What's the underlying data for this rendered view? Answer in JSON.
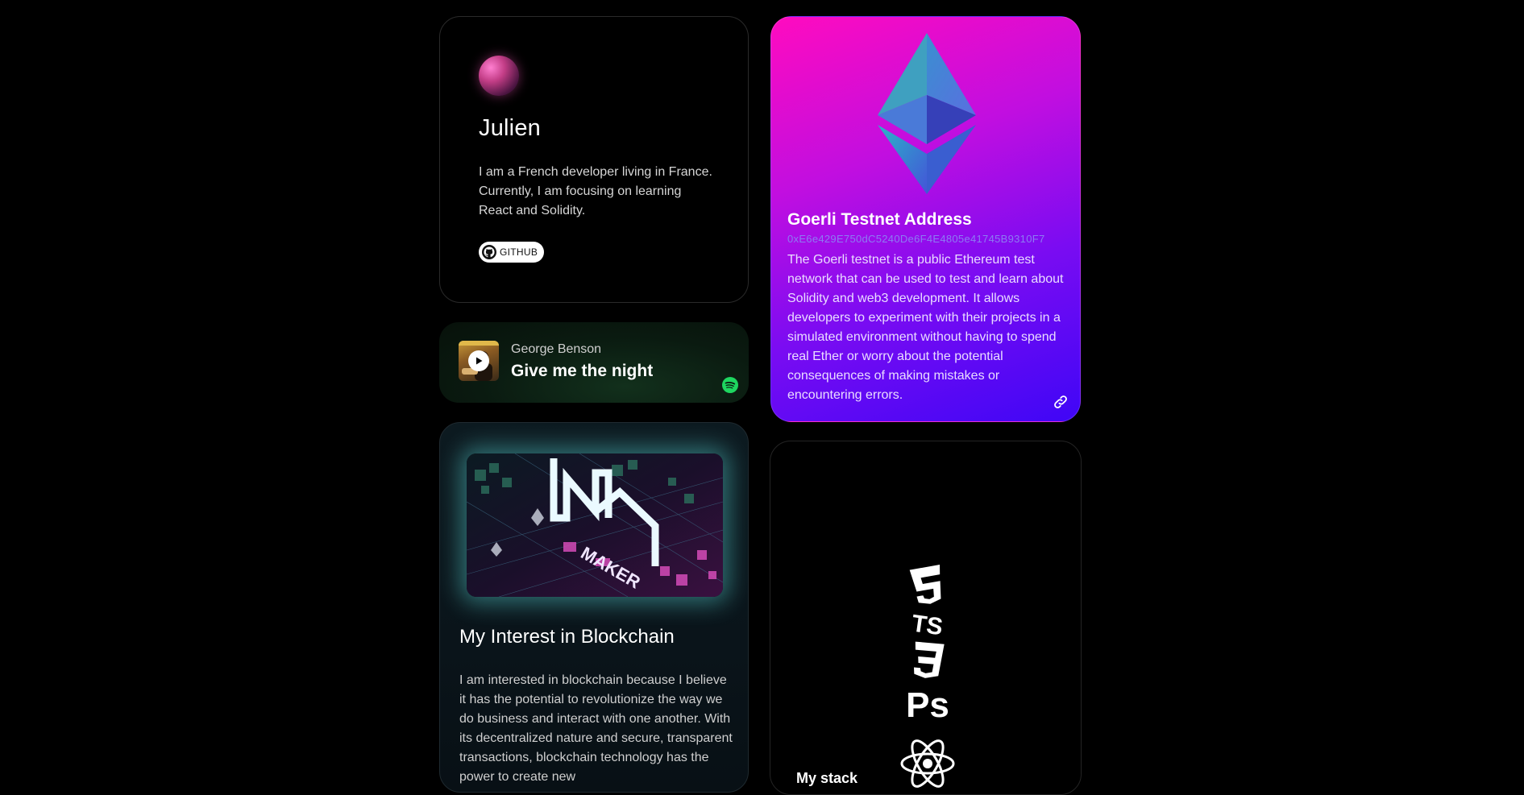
{
  "profile": {
    "name": "Julien",
    "bio": "I am a French developer living in France. Currently, I am focusing on learning React and Solidity.",
    "github_label": "GITHUB"
  },
  "music": {
    "artist": "George Benson",
    "track": "Give me the night",
    "service_icon": "spotify-icon"
  },
  "blockchain": {
    "title": "My Interest in Blockchain",
    "body": "I am interested in blockchain because I believe it has the potential to revolutionize the way we do business and interact with one another. With its decentralized nature and secure, transparent transactions, blockchain technology has the power to create new"
  },
  "ethereum": {
    "title": "Goerli Testnet Address",
    "address": "0xE6e429E750dC5240De6F4E4805e41745B9310F7",
    "description": "The Goerli testnet is a public Ethereum test network that can be used to test and learn about Solidity and web3 development. It allows developers to experiment with their projects in a simulated environment without having to spend real Ether or worry about the potential consequences of making mistakes or encountering errors."
  },
  "stack": {
    "label": "My stack",
    "icons": [
      "html5-icon",
      "typescript-icon",
      "css3-icon",
      "photoshop-icon",
      "react-icon"
    ]
  },
  "colors": {
    "background": "#000000",
    "eth_gradient_start": "#ff0bbf",
    "eth_gradient_end": "#3f06f6",
    "address_color": "#8d7bf2",
    "spotify_green": "#1ed760",
    "glow_cyan": "#5adcdc"
  }
}
